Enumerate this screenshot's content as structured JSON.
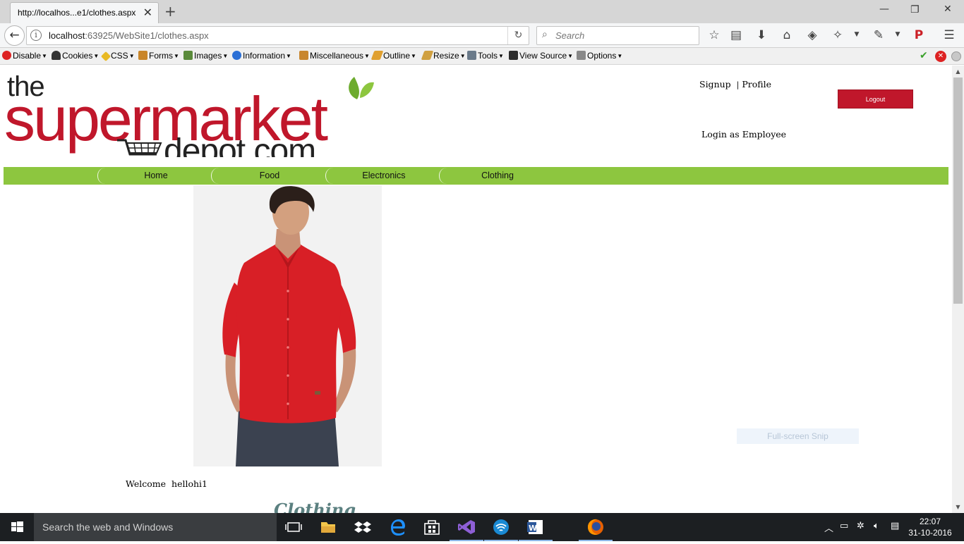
{
  "browser": {
    "tab_title": "http://localhos...e1/clothes.aspx",
    "url_host": "localhost",
    "url_path": ":63925/WebSite1/clothes.aspx",
    "search_placeholder": "Search"
  },
  "devbar": {
    "items": [
      {
        "label": "Disable",
        "icon": "disable-icon"
      },
      {
        "label": "Cookies",
        "icon": "cookies-icon"
      },
      {
        "label": "CSS",
        "icon": "css-icon"
      },
      {
        "label": "Forms",
        "icon": "forms-icon"
      },
      {
        "label": "Images",
        "icon": "images-icon"
      },
      {
        "label": "Information",
        "icon": "information-icon"
      },
      {
        "label": "Miscellaneous",
        "icon": "miscellaneous-icon"
      },
      {
        "label": "Outline",
        "icon": "outline-icon"
      },
      {
        "label": "Resize",
        "icon": "resize-icon"
      },
      {
        "label": "Tools",
        "icon": "tools-icon"
      },
      {
        "label": "View Source",
        "icon": "view-source-icon"
      },
      {
        "label": "Options",
        "icon": "options-icon"
      }
    ]
  },
  "site": {
    "logo": {
      "line1": "the",
      "line2": "supermarket",
      "line3": "depot.com"
    },
    "links": {
      "signup": "Signup",
      "separator": "|",
      "profile": "Profile"
    },
    "logout_label": "Logout",
    "employee_login": "Login as Employee",
    "menu": [
      "Home",
      "Food",
      "Electronics",
      "Clothing"
    ],
    "welcome_label": "Welcome",
    "username": "hellohi1",
    "section_title": "Clothing",
    "overlay_text": "Full-screen Snip"
  },
  "colors": {
    "brand_red": "#c0172b",
    "menu_green": "#8dc63f",
    "shirt_red": "#d81f26"
  },
  "taskbar": {
    "search_placeholder": "Search the web and Windows",
    "time": "22:07",
    "date": "31-10-2016"
  }
}
